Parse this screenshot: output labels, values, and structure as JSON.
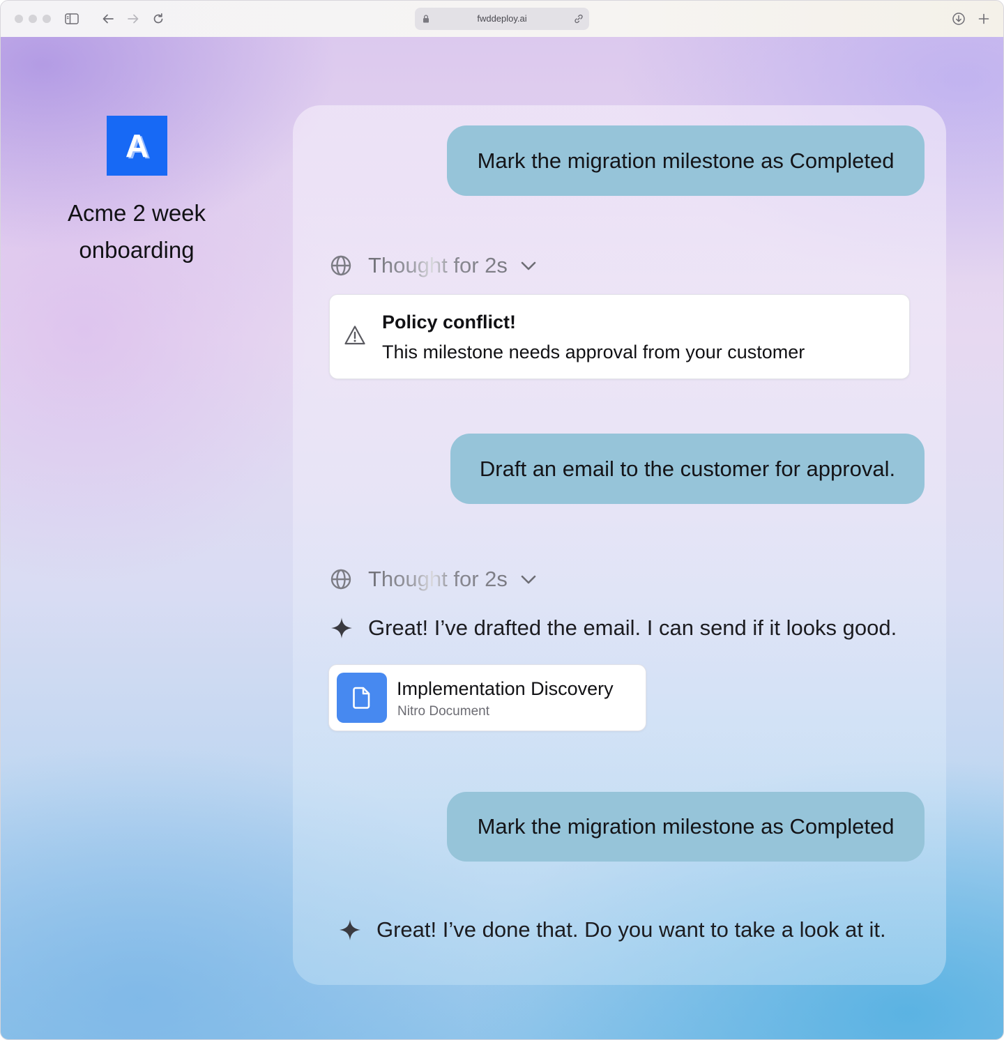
{
  "browser": {
    "url": "fwddeploy.ai"
  },
  "sidebar": {
    "logo_letter": "A",
    "project_title_line1": "Acme 2 week",
    "project_title_line2": "onboarding"
  },
  "chat": {
    "messages": [
      {
        "role": "user",
        "text": "Mark the migration milestone as Completed"
      },
      {
        "role": "thought",
        "text": "Thought for 2s"
      },
      {
        "role": "alert",
        "title": "Policy conflict!",
        "text": "This milestone needs approval from your customer"
      },
      {
        "role": "user",
        "text": "Draft an email to the customer for approval."
      },
      {
        "role": "thought",
        "text": "Thought for 2s"
      },
      {
        "role": "assistant",
        "text": "Great! I’ve drafted the email. I can send if it looks good."
      },
      {
        "role": "attachment",
        "title": "Implementation Discovery",
        "subtitle": "Nitro Document"
      },
      {
        "role": "user",
        "text": "Mark the migration milestone as Completed"
      },
      {
        "role": "assistant",
        "text": "Great! I’ve done that. Do you want to take a look at it."
      }
    ]
  },
  "colors": {
    "user_bubble": "#96c4d9",
    "logo_bg": "#1769f5",
    "doc_tile": "#4789f0"
  }
}
